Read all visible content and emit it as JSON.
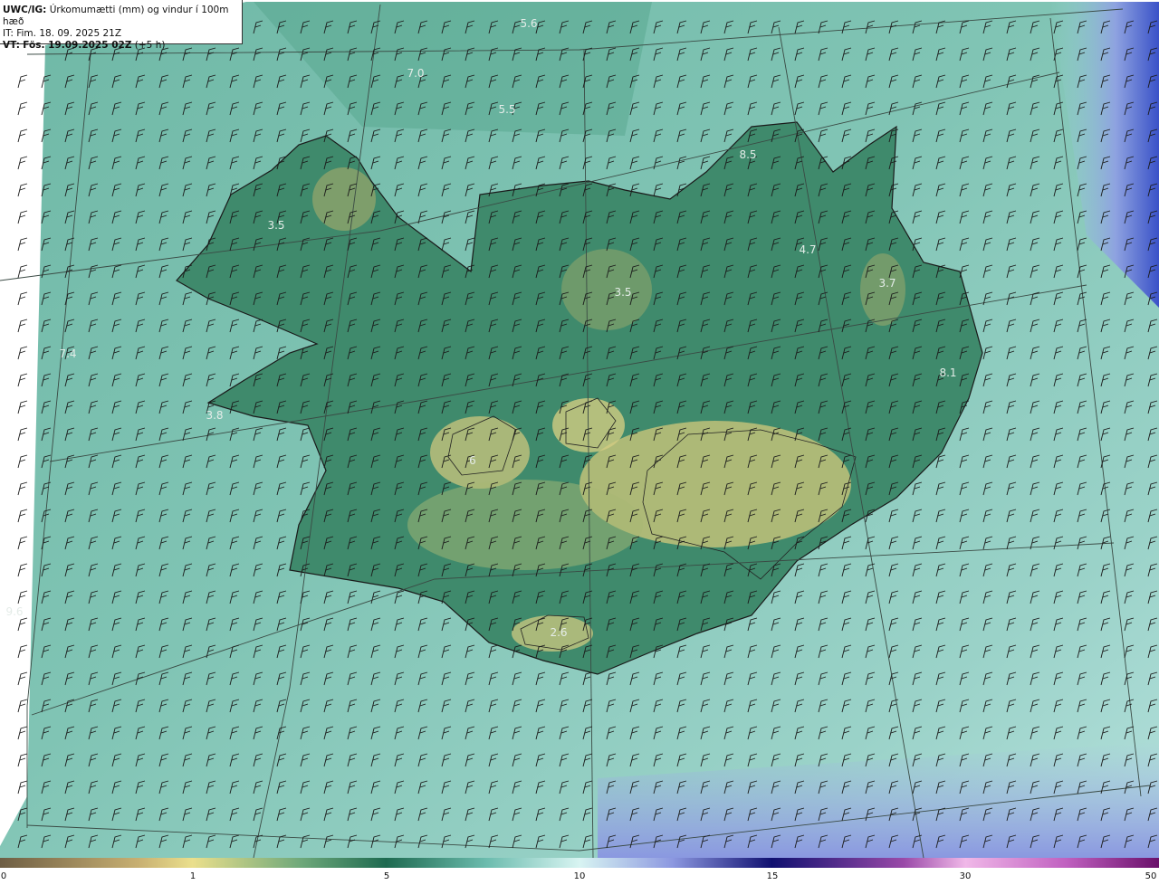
{
  "header": {
    "product": "UWC/IG:",
    "description": "Úrkomumætti (mm) og vindur í 100m hæð",
    "issue_time": "IT: Fim. 18. 09. 2025 21Z",
    "valid_prefix": "VT:",
    "valid_time": "Fös. 19.09.2025 02Z",
    "lead_time": "(+5 h)"
  },
  "map_labels": [
    {
      "text": "5.6"
    },
    {
      "text": "7.0"
    },
    {
      "text": "5.5"
    },
    {
      "text": "3.5"
    },
    {
      "text": "4.7"
    },
    {
      "text": "3.7"
    },
    {
      "text": "3.5"
    },
    {
      "text": "7.4"
    },
    {
      "text": "3.8"
    },
    {
      "text": "9.6"
    },
    {
      "text": "6"
    },
    {
      "text": "8.5"
    },
    {
      "text": "8.1"
    },
    {
      "text": "2.6"
    }
  ],
  "colorbar": {
    "ticks": [
      "0",
      "1",
      "5",
      "10",
      "15",
      "30",
      "50"
    ],
    "colors": {
      "low": "#7a6a4a",
      "yellow": "#e8dc8a",
      "green": "#2e7a5c",
      "teal": "#a8dcd6",
      "blue": "#2a3ab0",
      "navy": "#1a1a7a",
      "magenta": "#cc66cc",
      "purple": "#7a1a7a"
    }
  }
}
